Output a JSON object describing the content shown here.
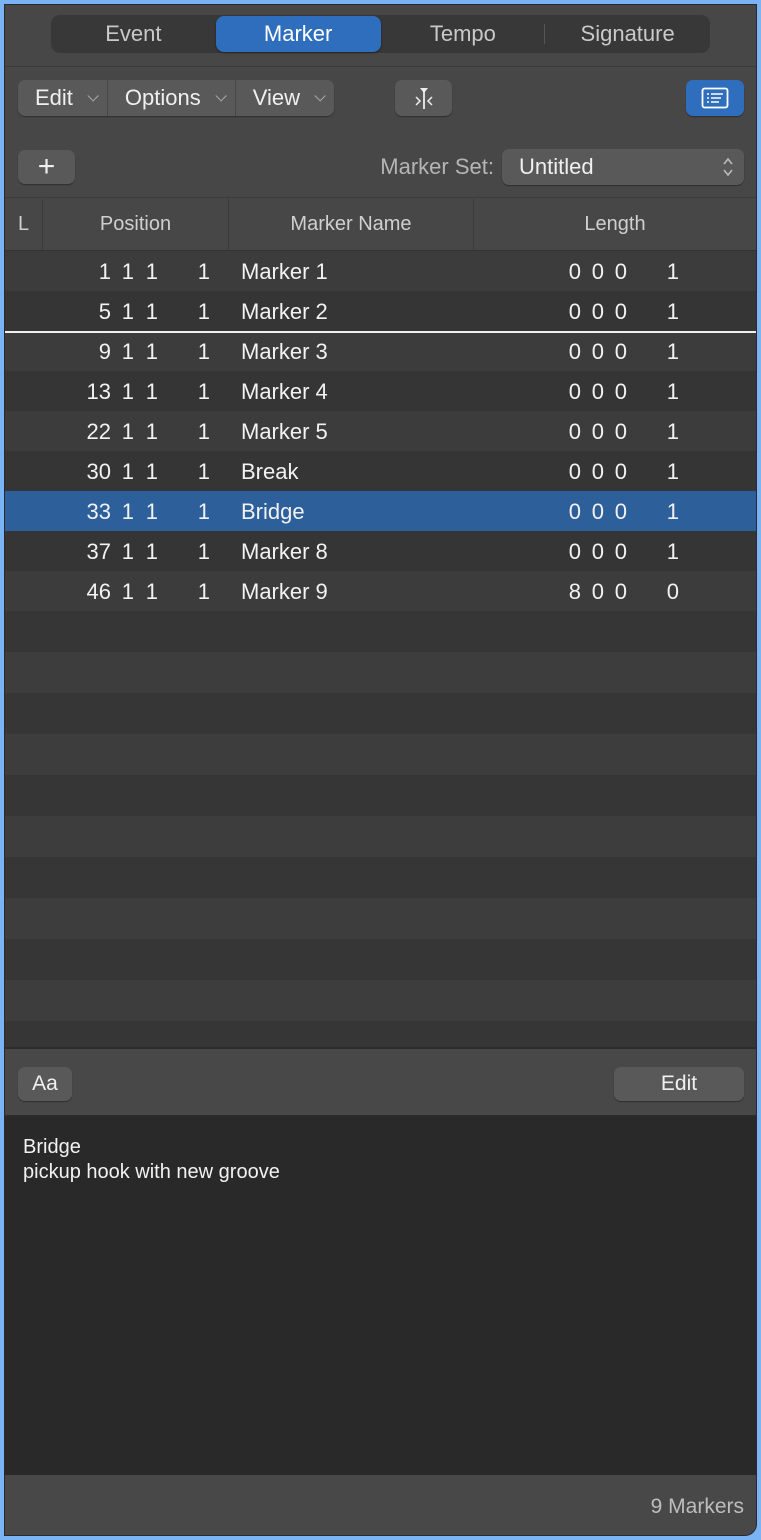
{
  "tabs": [
    {
      "label": "Event",
      "active": false
    },
    {
      "label": "Marker",
      "active": true
    },
    {
      "label": "Tempo",
      "active": false
    },
    {
      "label": "Signature",
      "active": false
    }
  ],
  "toolbar": {
    "menus": [
      {
        "label": "Edit"
      },
      {
        "label": "Options"
      },
      {
        "label": "View"
      }
    ],
    "catch_icon": "catch-playhead-icon",
    "list_icon": "list-view-icon"
  },
  "marker_set": {
    "add_label": "+",
    "label": "Marker Set:",
    "value": "Untitled"
  },
  "table": {
    "columns": [
      "L",
      "Position",
      "Marker Name",
      "Length"
    ],
    "rows": [
      {
        "pos": [
          "1",
          "1",
          "1",
          "1"
        ],
        "name": "Marker 1",
        "len": [
          "0",
          "0",
          "0",
          "1"
        ],
        "selected": false
      },
      {
        "pos": [
          "5",
          "1",
          "1",
          "1"
        ],
        "name": "Marker 2",
        "len": [
          "0",
          "0",
          "0",
          "1"
        ],
        "selected": false
      },
      {
        "pos": [
          "9",
          "1",
          "1",
          "1"
        ],
        "name": "Marker 3",
        "len": [
          "0",
          "0",
          "0",
          "1"
        ],
        "selected": false
      },
      {
        "pos": [
          "13",
          "1",
          "1",
          "1"
        ],
        "name": "Marker 4",
        "len": [
          "0",
          "0",
          "0",
          "1"
        ],
        "selected": false
      },
      {
        "pos": [
          "22",
          "1",
          "1",
          "1"
        ],
        "name": "Marker 5",
        "len": [
          "0",
          "0",
          "0",
          "1"
        ],
        "selected": false
      },
      {
        "pos": [
          "30",
          "1",
          "1",
          "1"
        ],
        "name": "Break",
        "len": [
          "0",
          "0",
          "0",
          "1"
        ],
        "selected": false
      },
      {
        "pos": [
          "33",
          "1",
          "1",
          "1"
        ],
        "name": "Bridge",
        "len": [
          "0",
          "0",
          "0",
          "1"
        ],
        "selected": true
      },
      {
        "pos": [
          "37",
          "1",
          "1",
          "1"
        ],
        "name": "Marker 8",
        "len": [
          "0",
          "0",
          "0",
          "1"
        ],
        "selected": false
      },
      {
        "pos": [
          "46",
          "1",
          "1",
          "1"
        ],
        "name": "Marker 9",
        "len": [
          "8",
          "0",
          "0",
          "0"
        ],
        "selected": false
      }
    ]
  },
  "notes_bar": {
    "font_label": "Aa",
    "edit_label": "Edit"
  },
  "notes": {
    "title": "Bridge",
    "body": "pickup hook with new groove"
  },
  "status": {
    "count": "9 Markers"
  },
  "colors": {
    "accent": "#2e6ebd",
    "selection": "#2d5f9b"
  }
}
